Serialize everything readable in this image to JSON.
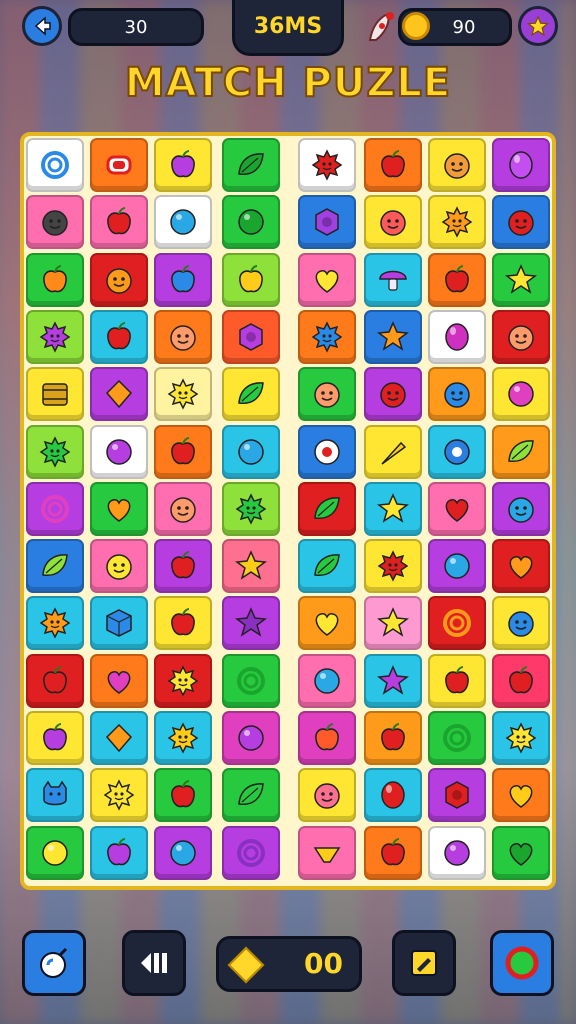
{
  "title": "MATCH PUZLE",
  "hud": {
    "score": "30",
    "timer": "36MS",
    "coins": "90",
    "gems": "00"
  },
  "colors": {
    "gold": "#ffd62a",
    "board_border": "#e3b521",
    "panel": "#1f2538",
    "button_blue": "#2a7de1"
  },
  "board": {
    "rows": [
      [
        {
          "bg": "#ffffff",
          "icon": "swirl",
          "fg": "#2a8ae6"
        },
        {
          "bg": "#ff7a1a",
          "icon": "candy",
          "fg": "#e02020"
        },
        {
          "bg": "#ffe633",
          "icon": "apple",
          "fg": "#b63ee0"
        },
        {
          "bg": "#27c93f",
          "icon": "leaf",
          "fg": "#1aa62e"
        },
        {
          "bg": "#ffffff",
          "icon": "flower",
          "fg": "#e02020"
        },
        {
          "bg": "#ff7a1a",
          "icon": "apple",
          "fg": "#e02020"
        },
        {
          "bg": "#ffe633",
          "icon": "face",
          "fg": "#f39a3a"
        },
        {
          "bg": "#b63ee0",
          "icon": "gem",
          "fg": "#c44ff0"
        }
      ],
      [
        {
          "bg": "#ff6fb0",
          "icon": "face",
          "fg": "#444444"
        },
        {
          "bg": "#ff6fb0",
          "icon": "apple",
          "fg": "#e02020"
        },
        {
          "bg": "#ffffff",
          "icon": "circle",
          "fg": "#2aa8e6"
        },
        {
          "bg": "#27c93f",
          "icon": "circle",
          "fg": "#1aa62e"
        },
        {
          "bg": "#2a7de1",
          "icon": "hexagon",
          "fg": "#a040e0"
        },
        {
          "bg": "#ffe633",
          "icon": "face",
          "fg": "#ff5a5a"
        },
        {
          "bg": "#ffe633",
          "icon": "flower",
          "fg": "#ff9a1a"
        },
        {
          "bg": "#2a7de1",
          "icon": "face",
          "fg": "#e02020"
        }
      ],
      [
        {
          "bg": "#27c93f",
          "icon": "apple",
          "fg": "#ff8a1a"
        },
        {
          "bg": "#e02020",
          "icon": "face",
          "fg": "#ff9a1a"
        },
        {
          "bg": "#b63ee0",
          "icon": "apple",
          "fg": "#2a8ae6"
        },
        {
          "bg": "#8ee03a",
          "icon": "apple",
          "fg": "#ffcc1a"
        },
        {
          "bg": "#ff6fb0",
          "icon": "heart",
          "fg": "#ffe633"
        },
        {
          "bg": "#2ac4e6",
          "icon": "mushroom",
          "fg": "#b63ee0"
        },
        {
          "bg": "#ff7a1a",
          "icon": "apple",
          "fg": "#e02020"
        },
        {
          "bg": "#27c93f",
          "icon": "star",
          "fg": "#ffe633"
        }
      ],
      [
        {
          "bg": "#8ee03a",
          "icon": "flower",
          "fg": "#b63ee0"
        },
        {
          "bg": "#2ac4e6",
          "icon": "apple",
          "fg": "#e02020"
        },
        {
          "bg": "#ff7a1a",
          "icon": "face",
          "fg": "#ff9a6a"
        },
        {
          "bg": "#ff5a2a",
          "icon": "hexagon",
          "fg": "#b63ee0"
        },
        {
          "bg": "#ff7a1a",
          "icon": "flower",
          "fg": "#2a8ae6"
        },
        {
          "bg": "#2a7de1",
          "icon": "star",
          "fg": "#ff9a1a"
        },
        {
          "bg": "#ffffff",
          "icon": "gem",
          "fg": "#d030c0"
        },
        {
          "bg": "#e02020",
          "icon": "face",
          "fg": "#ff9a6a"
        }
      ],
      [
        {
          "bg": "#ffe633",
          "icon": "barrel",
          "fg": "#d9a21a"
        },
        {
          "bg": "#b63ee0",
          "icon": "diamond",
          "fg": "#ff9a1a"
        },
        {
          "bg": "#fff3a0",
          "icon": "flower",
          "fg": "#ffe633"
        },
        {
          "bg": "#ffe633",
          "icon": "leaf",
          "fg": "#27c93f"
        },
        {
          "bg": "#27c93f",
          "icon": "face",
          "fg": "#ff9a6a"
        },
        {
          "bg": "#b63ee0",
          "icon": "face",
          "fg": "#e02020"
        },
        {
          "bg": "#ff9a1a",
          "icon": "face",
          "fg": "#2a8ae6"
        },
        {
          "bg": "#ffe633",
          "icon": "circle",
          "fg": "#e040c0"
        }
      ],
      [
        {
          "bg": "#8ee03a",
          "icon": "flower",
          "fg": "#27c93f"
        },
        {
          "bg": "#ffffff",
          "icon": "circle",
          "fg": "#b63ee0"
        },
        {
          "bg": "#ff7a1a",
          "icon": "apple",
          "fg": "#e02020"
        },
        {
          "bg": "#2ac4e6",
          "icon": "circle",
          "fg": "#2aa8e6"
        },
        {
          "bg": "#2a7de1",
          "icon": "donut",
          "fg": "#e02020"
        },
        {
          "bg": "#ffe633",
          "icon": "carrot",
          "fg": "#ffcc1a"
        },
        {
          "bg": "#2ac4e6",
          "icon": "gear",
          "fg": "#2a7de1"
        },
        {
          "bg": "#ff9a1a",
          "icon": "leaf",
          "fg": "#8ee03a"
        }
      ],
      [
        {
          "bg": "#b63ee0",
          "icon": "swirl",
          "fg": "#e040c0"
        },
        {
          "bg": "#27c93f",
          "icon": "heart",
          "fg": "#ff9a1a"
        },
        {
          "bg": "#ff6fb0",
          "icon": "face",
          "fg": "#ff9a6a"
        },
        {
          "bg": "#8ee03a",
          "icon": "flower",
          "fg": "#27c93f"
        },
        {
          "bg": "#e02020",
          "icon": "leaf",
          "fg": "#27c93f"
        },
        {
          "bg": "#2ac4e6",
          "icon": "star",
          "fg": "#ffe633"
        },
        {
          "bg": "#ff6fb0",
          "icon": "heart",
          "fg": "#e02020"
        },
        {
          "bg": "#b63ee0",
          "icon": "face",
          "fg": "#2aa8e6"
        }
      ],
      [
        {
          "bg": "#2a7de1",
          "icon": "leaf",
          "fg": "#8ee03a"
        },
        {
          "bg": "#ff6fb0",
          "icon": "face",
          "fg": "#ffe633"
        },
        {
          "bg": "#b63ee0",
          "icon": "apple",
          "fg": "#e02020"
        },
        {
          "bg": "#ff6f8f",
          "icon": "star",
          "fg": "#ffcc1a"
        },
        {
          "bg": "#2ac4e6",
          "icon": "leaf",
          "fg": "#27c93f"
        },
        {
          "bg": "#ffe633",
          "icon": "flower",
          "fg": "#e02020"
        },
        {
          "bg": "#b63ee0",
          "icon": "circle",
          "fg": "#2aa8e6"
        },
        {
          "bg": "#e02020",
          "icon": "heart",
          "fg": "#ff9a1a"
        }
      ],
      [
        {
          "bg": "#2ac4e6",
          "icon": "flower",
          "fg": "#ff9a1a"
        },
        {
          "bg": "#2ac4e6",
          "icon": "cube",
          "fg": "#2a8ae6"
        },
        {
          "bg": "#ffe633",
          "icon": "apple",
          "fg": "#e02020"
        },
        {
          "bg": "#b63ee0",
          "icon": "star",
          "fg": "#8a30c0"
        },
        {
          "bg": "#ff9a1a",
          "icon": "heart",
          "fg": "#ffe633"
        },
        {
          "bg": "#ff9ad0",
          "icon": "star",
          "fg": "#ffe633"
        },
        {
          "bg": "#e02020",
          "icon": "swirl",
          "fg": "#ff9a1a"
        },
        {
          "bg": "#ffe633",
          "icon": "face",
          "fg": "#2a8ae6"
        }
      ],
      [
        {
          "bg": "#e02020",
          "icon": "apple",
          "fg": "#e02020"
        },
        {
          "bg": "#ff7a1a",
          "icon": "heart",
          "fg": "#e040c0"
        },
        {
          "bg": "#e02020",
          "icon": "flower",
          "fg": "#ffe633"
        },
        {
          "bg": "#27c93f",
          "icon": "swirl",
          "fg": "#1aa62e"
        },
        {
          "bg": "#ff6fb0",
          "icon": "circle",
          "fg": "#2aa8e6"
        },
        {
          "bg": "#2ac4e6",
          "icon": "star",
          "fg": "#b63ee0"
        },
        {
          "bg": "#ffe633",
          "icon": "apple",
          "fg": "#e02020"
        },
        {
          "bg": "#ff3a6a",
          "icon": "apple",
          "fg": "#e02020"
        }
      ],
      [
        {
          "bg": "#ffe633",
          "icon": "apple",
          "fg": "#b63ee0"
        },
        {
          "bg": "#2ac4e6",
          "icon": "diamond",
          "fg": "#ff9a1a"
        },
        {
          "bg": "#2ac4e6",
          "icon": "flower",
          "fg": "#ffcc1a"
        },
        {
          "bg": "#e040c0",
          "icon": "circle",
          "fg": "#b63ee0"
        },
        {
          "bg": "#e040c0",
          "icon": "apple",
          "fg": "#ff5a2a"
        },
        {
          "bg": "#ff9a1a",
          "icon": "apple",
          "fg": "#e02020"
        },
        {
          "bg": "#27c93f",
          "icon": "swirl",
          "fg": "#1aa62e"
        },
        {
          "bg": "#2ac4e6",
          "icon": "flower",
          "fg": "#ffe633"
        }
      ],
      [
        {
          "bg": "#2ac4e6",
          "icon": "cat",
          "fg": "#2a8ae6"
        },
        {
          "bg": "#ffe633",
          "icon": "flower",
          "fg": "#ffe633"
        },
        {
          "bg": "#27c93f",
          "icon": "apple",
          "fg": "#e02020"
        },
        {
          "bg": "#27c93f",
          "icon": "leaf",
          "fg": "#27c93f"
        },
        {
          "bg": "#ffe633",
          "icon": "face",
          "fg": "#ff6f8f"
        },
        {
          "bg": "#2ac4e6",
          "icon": "gem",
          "fg": "#e02020"
        },
        {
          "bg": "#b63ee0",
          "icon": "hexagon",
          "fg": "#e02020"
        },
        {
          "bg": "#ff7a1a",
          "icon": "heart",
          "fg": "#ffcc1a"
        }
      ],
      [
        {
          "bg": "#27c93f",
          "icon": "circle",
          "fg": "#ffe633"
        },
        {
          "bg": "#2ac4e6",
          "icon": "apple",
          "fg": "#b63ee0"
        },
        {
          "bg": "#b63ee0",
          "icon": "circle",
          "fg": "#2aa8e6"
        },
        {
          "bg": "#b63ee0",
          "icon": "swirl",
          "fg": "#8a30c0"
        },
        {
          "bg": "#ff6fb0",
          "icon": "bowl",
          "fg": "#ffcc1a"
        },
        {
          "bg": "#ff7a1a",
          "icon": "apple",
          "fg": "#e02020"
        },
        {
          "bg": "#ffffff",
          "icon": "circle",
          "fg": "#b63ee0"
        },
        {
          "bg": "#27c93f",
          "icon": "heart",
          "fg": "#1aa62e"
        }
      ]
    ]
  }
}
